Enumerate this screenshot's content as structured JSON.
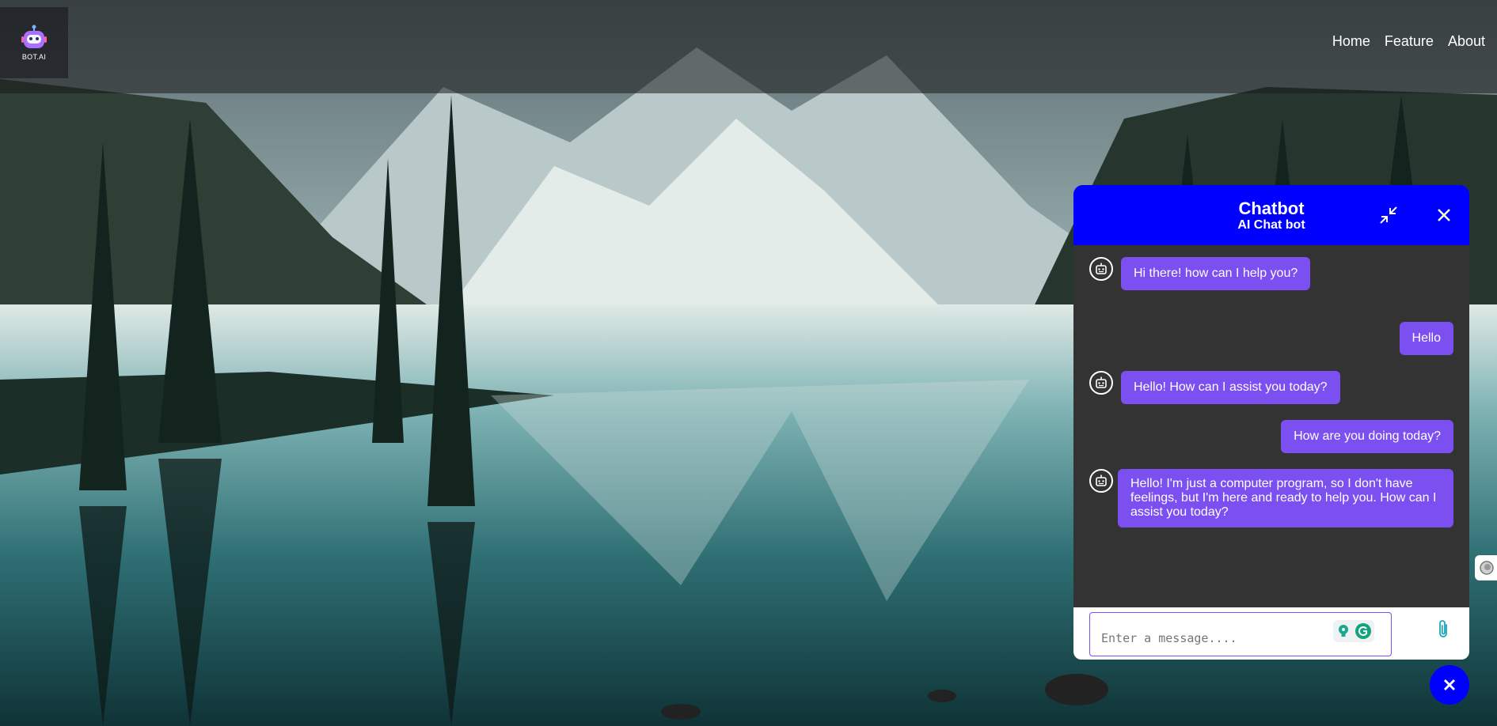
{
  "brand": {
    "logo_text": "BOT.AI"
  },
  "nav": {
    "items": [
      {
        "label": "Home"
      },
      {
        "label": "Feature"
      },
      {
        "label": "About"
      }
    ]
  },
  "chatbot": {
    "title": "Chatbot",
    "subtitle": "AI Chat bot",
    "header_color": "#0000ff",
    "bubble_color": "#7b4ff0",
    "body_color": "#333333",
    "messages": [
      {
        "sender": "bot",
        "text": "Hi there! how can I help you?"
      },
      {
        "sender": "user",
        "text": "Hello"
      },
      {
        "sender": "bot",
        "text": "Hello! How can I assist you today?"
      },
      {
        "sender": "user",
        "text": "How are you doing today?"
      },
      {
        "sender": "bot",
        "text": "Hello! I'm just a computer program, so I don't have feelings, but I'm here and ready to help you. How can I assist you today?"
      }
    ],
    "input": {
      "placeholder": "Enter a message....",
      "value": ""
    }
  },
  "icons": {
    "logo": "robot-logo-icon",
    "minimize": "minimize-arrows-icon",
    "close": "close-icon",
    "bot_avatar": "robot-avatar-icon",
    "attach": "paperclip-icon",
    "fab": "close-icon",
    "grammarly": "grammarly-icon"
  }
}
